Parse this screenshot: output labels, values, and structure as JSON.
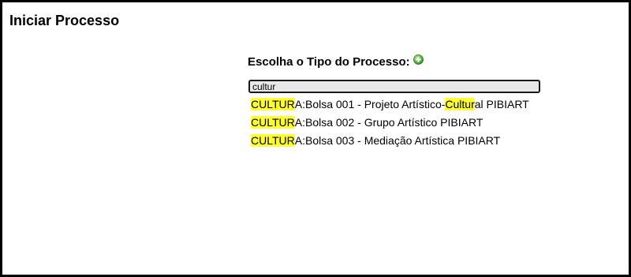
{
  "page": {
    "title": "Iniciar Processo"
  },
  "process": {
    "label": "Escolha o Tipo do Processo:",
    "add_icon": "plus-circle-icon",
    "search": {
      "value": "cultur",
      "placeholder": ""
    },
    "suggestions": [
      {
        "parts": [
          {
            "text": "CULTUR",
            "hl": true
          },
          {
            "text": "A:Bolsa 001 - Projeto Artístico-",
            "hl": false
          },
          {
            "text": "Cultur",
            "hl": true
          },
          {
            "text": "al PIBIART",
            "hl": false
          }
        ]
      },
      {
        "parts": [
          {
            "text": "CULTUR",
            "hl": true
          },
          {
            "text": "A:Bolsa 002 - Grupo Artístico PIBIART",
            "hl": false
          }
        ]
      },
      {
        "parts": [
          {
            "text": "CULTUR",
            "hl": true
          },
          {
            "text": "A:Bolsa 003 - Mediação Artística PIBIART",
            "hl": false
          }
        ]
      }
    ]
  },
  "colors": {
    "highlight": "#ffff33",
    "border": "#000000",
    "input_bg": "#e8e8e8",
    "icon_green": "#3a9a2e"
  }
}
